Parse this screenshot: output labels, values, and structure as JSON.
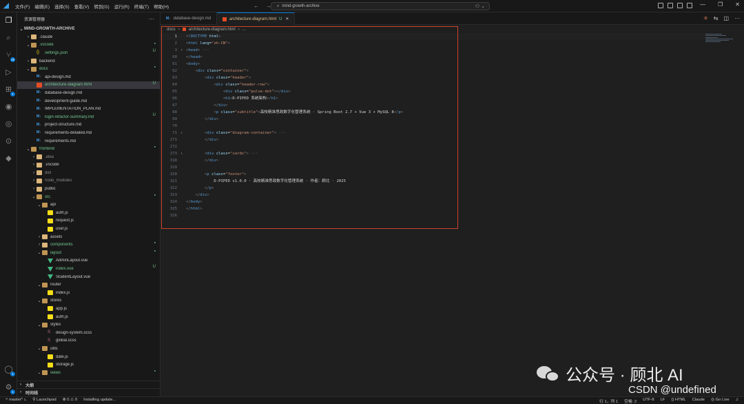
{
  "titlebar": {
    "menus": [
      "文件(F)",
      "编辑(E)",
      "选择(S)",
      "查看(V)",
      "转到(G)",
      "运行(R)",
      "终端(T)",
      "帮助(H)"
    ],
    "search_value": "mind-growth-archive"
  },
  "activity_bar": {
    "icons": [
      "explorer-icon",
      "search-icon",
      "source-control-icon",
      "run-debug-icon",
      "extensions-icon",
      "github-icon",
      "gitlens-icon",
      "remote-icon",
      "chat-icon",
      "account-icon",
      "settings-icon"
    ],
    "source_control_badge": "15",
    "extensions_badge": "1",
    "account_badge": "1",
    "settings_badge": "1"
  },
  "sidebar": {
    "title": "资源管理器",
    "root": "MIND-GROWTH-ARCHIVE",
    "tree": [
      {
        "label": ".claude",
        "depth": 1,
        "type": "folder",
        "open": false,
        "color": "#cccccc"
      },
      {
        "label": ".vscode",
        "depth": 1,
        "type": "folder",
        "open": true,
        "color": "#73c991",
        "stat": "●"
      },
      {
        "label": "settings.json",
        "depth": 2,
        "type": "json",
        "color": "#73c991",
        "stat": "U"
      },
      {
        "label": "backend",
        "depth": 1,
        "type": "folder",
        "open": false,
        "color": "#cccccc"
      },
      {
        "label": "docs",
        "depth": 1,
        "type": "folder",
        "open": true,
        "color": "#73c991",
        "stat": "●"
      },
      {
        "label": "api-design.md",
        "depth": 2,
        "type": "md",
        "color": "#cccccc"
      },
      {
        "label": "architecture-diagram.html",
        "depth": 2,
        "type": "html",
        "color": "#73c991",
        "stat": "U",
        "selected": true
      },
      {
        "label": "database-design.md",
        "depth": 2,
        "type": "md",
        "color": "#cccccc"
      },
      {
        "label": "development-guide.md",
        "depth": 2,
        "type": "md",
        "color": "#cccccc"
      },
      {
        "label": "IMPLEMENTATION_PLAN.md",
        "depth": 2,
        "type": "md",
        "color": "#cccccc"
      },
      {
        "label": "login-refactor-summary.md",
        "depth": 2,
        "type": "md",
        "color": "#73c991",
        "stat": "U"
      },
      {
        "label": "project-structure.md",
        "depth": 2,
        "type": "md",
        "color": "#cccccc"
      },
      {
        "label": "requirements-detailed.md",
        "depth": 2,
        "type": "md",
        "color": "#cccccc"
      },
      {
        "label": "requirements.md",
        "depth": 2,
        "type": "md",
        "color": "#cccccc"
      },
      {
        "label": "frontend",
        "depth": 1,
        "type": "folder",
        "open": true,
        "color": "#73c991",
        "stat": "●"
      },
      {
        "label": ".idea",
        "depth": 2,
        "type": "folder",
        "open": false,
        "color": "#8c8c8c"
      },
      {
        "label": ".vscode",
        "depth": 2,
        "type": "folder",
        "open": false,
        "color": "#cccccc"
      },
      {
        "label": "dist",
        "depth": 2,
        "type": "folder",
        "open": false,
        "color": "#8c8c8c"
      },
      {
        "label": "node_modules",
        "depth": 2,
        "type": "folder",
        "open": false,
        "color": "#8c8c8c"
      },
      {
        "label": "public",
        "depth": 2,
        "type": "folder",
        "open": false,
        "color": "#cccccc"
      },
      {
        "label": "src",
        "depth": 2,
        "type": "folder",
        "open": true,
        "color": "#73c991",
        "stat": "●"
      },
      {
        "label": "api",
        "depth": 3,
        "type": "folder",
        "open": true,
        "color": "#cccccc"
      },
      {
        "label": "auth.js",
        "depth": 4,
        "type": "js",
        "color": "#cccccc"
      },
      {
        "label": "request.js",
        "depth": 4,
        "type": "js",
        "color": "#cccccc"
      },
      {
        "label": "user.js",
        "depth": 4,
        "type": "js",
        "color": "#cccccc"
      },
      {
        "label": "assets",
        "depth": 3,
        "type": "folder",
        "open": false,
        "color": "#cccccc"
      },
      {
        "label": "components",
        "depth": 3,
        "type": "folder",
        "open": false,
        "color": "#73c991",
        "stat": "●"
      },
      {
        "label": "layout",
        "depth": 3,
        "type": "folder",
        "open": true,
        "color": "#73c991",
        "stat": "●"
      },
      {
        "label": "AdminLayout.vue",
        "depth": 4,
        "type": "vue",
        "color": "#cccccc"
      },
      {
        "label": "index.vue",
        "depth": 4,
        "type": "vue",
        "color": "#73c991",
        "stat": "U"
      },
      {
        "label": "StudentLayout.vue",
        "depth": 4,
        "type": "vue",
        "color": "#cccccc"
      },
      {
        "label": "router",
        "depth": 3,
        "type": "folder",
        "open": true,
        "color": "#cccccc"
      },
      {
        "label": "index.js",
        "depth": 4,
        "type": "js",
        "color": "#cccccc"
      },
      {
        "label": "stores",
        "depth": 3,
        "type": "folder",
        "open": true,
        "color": "#cccccc"
      },
      {
        "label": "app.js",
        "depth": 4,
        "type": "js",
        "color": "#cccccc"
      },
      {
        "label": "auth.js",
        "depth": 4,
        "type": "js",
        "color": "#cccccc"
      },
      {
        "label": "styles",
        "depth": 3,
        "type": "folder",
        "open": true,
        "color": "#cccccc"
      },
      {
        "label": "design-system.scss",
        "depth": 4,
        "type": "scss",
        "color": "#cccccc"
      },
      {
        "label": "global.scss",
        "depth": 4,
        "type": "scss",
        "color": "#cccccc"
      },
      {
        "label": "utils",
        "depth": 3,
        "type": "folder",
        "open": true,
        "color": "#cccccc"
      },
      {
        "label": "date.js",
        "depth": 4,
        "type": "js",
        "color": "#cccccc"
      },
      {
        "label": "storage.js",
        "depth": 4,
        "type": "js",
        "color": "#cccccc"
      },
      {
        "label": "views",
        "depth": 3,
        "type": "folder",
        "open": true,
        "color": "#73c991",
        "stat": "●"
      }
    ],
    "outline_label": "大纲",
    "timeline_label": "时间线"
  },
  "tabs": [
    {
      "label": "database-design.md",
      "type": "md",
      "active": false
    },
    {
      "label": "architecture-diagram.html",
      "type": "html",
      "active": true,
      "status": "U"
    }
  ],
  "breadcrumb": [
    "docs",
    "architecture-diagram.html",
    "..."
  ],
  "code_lines": [
    {
      "n": "1",
      "fold": "",
      "html": "<span class='t'>&lt;</span><span class='tag'>!DOCTYPE</span> <span class='attr'>html</span><span class='t'>&gt;</span>"
    },
    {
      "n": "2",
      "fold": "",
      "html": "<span class='t'>&lt;</span><span class='tag'>html</span> <span class='attr'>lang</span><span class='txt'>=</span><span class='str'>\"zh-CN\"</span><span class='t'>&gt;</span>"
    },
    {
      "n": "3",
      "fold": "›",
      "html": "<span class='t'>&lt;</span><span class='tag'>head</span><span class='t'>&gt;</span> <span class='ell'>···</span>"
    },
    {
      "n": "60",
      "fold": "",
      "html": "<span class='t'>&lt;/</span><span class='tag'>head</span><span class='t'>&gt;</span>"
    },
    {
      "n": "61",
      "fold": "",
      "html": "<span class='t'>&lt;</span><span class='tag'>body</span><span class='t'>&gt;</span>"
    },
    {
      "n": "62",
      "fold": "",
      "html": "    <span class='t'>&lt;</span><span class='tag'>div</span> <span class='attr'>class</span><span class='txt'>=</span><span class='str'>\"container\"</span><span class='t'>&gt;</span>"
    },
    {
      "n": "63",
      "fold": "",
      "html": "        <span class='t'>&lt;</span><span class='tag'>div</span> <span class='attr'>class</span><span class='txt'>=</span><span class='str'>\"header\"</span><span class='t'>&gt;</span>"
    },
    {
      "n": "64",
      "fold": "",
      "html": "            <span class='t'>&lt;</span><span class='tag'>div</span> <span class='attr'>class</span><span class='txt'>=</span><span class='str'>\"header-row\"</span><span class='t'>&gt;</span>"
    },
    {
      "n": "65",
      "fold": "",
      "html": "                <span class='t'>&lt;</span><span class='tag'>div</span> <span class='attr'>class</span><span class='txt'>=</span><span class='str'>\"pulse-dot\"</span><span class='t'>&gt;&lt;/</span><span class='tag'>div</span><span class='t'>&gt;</span>"
    },
    {
      "n": "66",
      "fold": "",
      "html": "                <span class='t'>&lt;</span><span class='tag'>h1</span><span class='t'>&gt;</span><span class='txt'>D-PIPED 系统架构</span><span class='t'>&lt;/</span><span class='tag'>h1</span><span class='t'>&gt;</span>"
    },
    {
      "n": "67",
      "fold": "",
      "html": "            <span class='t'>&lt;/</span><span class='tag'>div</span><span class='t'>&gt;</span>"
    },
    {
      "n": "68",
      "fold": "",
      "html": "            <span class='t'>&lt;</span><span class='tag'>p</span> <span class='attr'>class</span><span class='txt'>=</span><span class='str'>\"subtitle\"</span><span class='t'>&gt;</span><span class='txt'>高校精准思政数字化管理系统 · Spring Boot 2.7 + Vue 3 + MySQL 8</span><span class='t'>&lt;/</span><span class='tag'>p</span><span class='t'>&gt;</span>"
    },
    {
      "n": "69",
      "fold": "",
      "html": "        <span class='t'>&lt;/</span><span class='tag'>div</span><span class='t'>&gt;</span>"
    },
    {
      "n": "70",
      "fold": "",
      "html": ""
    },
    {
      "n": "71",
      "fold": "›",
      "html": "        <span class='t'>&lt;</span><span class='tag'>div</span> <span class='attr'>class</span><span class='txt'>=</span><span class='str'>\"diagram-container\"</span><span class='t'>&gt;</span> <span class='ell'>···</span>"
    },
    {
      "n": "271",
      "fold": "",
      "html": "        <span class='t'>&lt;/</span><span class='tag'>div</span><span class='t'>&gt;</span>"
    },
    {
      "n": "272",
      "fold": "",
      "html": ""
    },
    {
      "n": "273",
      "fold": "›",
      "html": "        <span class='t'>&lt;</span><span class='tag'>div</span> <span class='attr'>class</span><span class='txt'>=</span><span class='str'>\"cards\"</span><span class='t'>&gt;</span> <span class='ell'>···</span>"
    },
    {
      "n": "318",
      "fold": "",
      "html": "        <span class='t'>&lt;/</span><span class='tag'>div</span><span class='t'>&gt;</span>"
    },
    {
      "n": "319",
      "fold": "",
      "html": ""
    },
    {
      "n": "320",
      "fold": "",
      "html": "        <span class='t'>&lt;</span><span class='tag'>p</span> <span class='attr'>class</span><span class='txt'>=</span><span class='str'>\"footer\"</span><span class='t'>&gt;</span>"
    },
    {
      "n": "321",
      "fold": "",
      "html": "            <span class='txt'>D-PIPED v1.0.0 · 高校精准思政数字化管理系统 · 作者：顾北 · 2025</span>"
    },
    {
      "n": "322",
      "fold": "",
      "html": "        <span class='t'>&lt;/</span><span class='tag'>p</span><span class='t'>&gt;</span>"
    },
    {
      "n": "323",
      "fold": "",
      "html": "    <span class='t'>&lt;/</span><span class='tag'>div</span><span class='t'>&gt;</span>"
    },
    {
      "n": "324",
      "fold": "",
      "html": "<span class='t'>&lt;/</span><span class='tag'>body</span><span class='t'>&gt;</span>"
    },
    {
      "n": "325",
      "fold": "",
      "html": "<span class='t'>&lt;/</span><span class='tag'>html</span><span class='t'>&gt;</span>"
    },
    {
      "n": "326",
      "fold": "",
      "html": ""
    }
  ],
  "statusbar": {
    "branch": "master*",
    "launchpad": "Launchpad",
    "problems": "⊗ 0  ⚠ 0",
    "progress": "Installing update...",
    "position": "行 1，列 1",
    "spaces": "空格: 2",
    "encoding": "UTF-8",
    "eol": "LF",
    "language": "HTML",
    "claude": "Claude",
    "golive": "Go Live"
  },
  "watermark": {
    "line1": "公众号 · 顾北 AI",
    "line2": "CSDN @undefined"
  },
  "colors": {
    "accent": "#0078d4",
    "git_untracked": "#73c991",
    "highlight_box": "#d0432f"
  }
}
